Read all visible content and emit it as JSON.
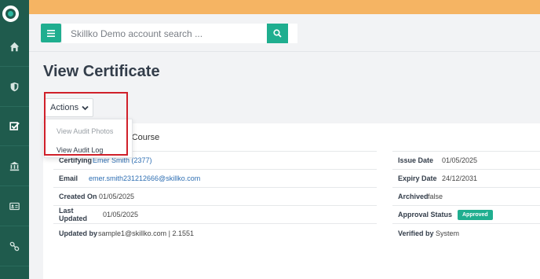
{
  "sidebar": {
    "items": [
      {
        "icon": "home-icon"
      },
      {
        "icon": "shield-icon"
      },
      {
        "icon": "check-square-icon"
      },
      {
        "icon": "bank-icon"
      },
      {
        "icon": "id-card-icon"
      },
      {
        "icon": "link-icon"
      }
    ]
  },
  "search": {
    "placeholder": "Skillko Demo account search ..."
  },
  "page": {
    "title": "View Certificate"
  },
  "actions": {
    "label": "Actions",
    "menu": {
      "items": [
        {
          "label": "View Audit Photos",
          "state": "disabled"
        },
        {
          "label": "View Audit Log",
          "state": "enabled"
        }
      ]
    }
  },
  "certificate": {
    "course": "nal Course",
    "left_fields": [
      {
        "label": "Certifying",
        "value": "Emer Smith (2377)",
        "link": true
      },
      {
        "label": "Email",
        "value": "emer.smith231212666@skillko.com",
        "link": true
      },
      {
        "label": "Created On",
        "value": "01/05/2025"
      },
      {
        "label": "Last Updated",
        "value": "01/05/2025"
      },
      {
        "label": "Updated by",
        "value": "sample1@skillko.com | 2.1551"
      }
    ],
    "right_fields": [
      {
        "label": "Issue Date",
        "value": "01/05/2025"
      },
      {
        "label": "Expiry Date",
        "value": "24/12/2031"
      },
      {
        "label": "Archived",
        "value": "false"
      },
      {
        "label": "Approval Status",
        "value": "Approved",
        "badge": true
      },
      {
        "label": "Verified by",
        "value": "System"
      }
    ]
  },
  "colors": {
    "sidebar": "#1f5b4d",
    "banner": "#f5b463",
    "accent": "#1fae8f",
    "highlight": "#d0202a",
    "link": "#2f6fb3"
  }
}
